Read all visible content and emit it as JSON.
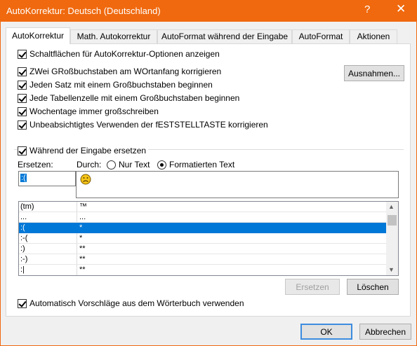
{
  "window": {
    "title": "AutoKorrektur: Deutsch (Deutschland)",
    "help_glyph": "?",
    "close_glyph": "✕",
    "accent_color": "#f0690e"
  },
  "tabs": [
    {
      "label": "AutoKorrektur",
      "active": true
    },
    {
      "label": "Math. Autokorrektur",
      "active": false
    },
    {
      "label": "AutoFormat während der Eingabe",
      "active": false
    },
    {
      "label": "AutoFormat",
      "active": false
    },
    {
      "label": "Aktionen",
      "active": false
    }
  ],
  "options": {
    "show_buttons": {
      "label": "Schaltflächen für AutoKorrektur-Optionen anzeigen",
      "checked": true
    },
    "two_caps": {
      "label": "ZWei GRoßbuchstaben am WOrtanfang korrigieren",
      "checked": true
    },
    "sentence_caps": {
      "label": "Jeden Satz mit einem Großbuchstaben beginnen",
      "checked": true
    },
    "table_cell_caps": {
      "label": "Jede Tabellenzelle mit einem Großbuchstaben beginnen",
      "checked": true
    },
    "weekday_caps": {
      "label": "Wochentage immer großschreiben",
      "checked": true
    },
    "caps_lock": {
      "label": "Unbeabsichtigtes Verwenden der fESTSTELLTASTE korrigieren",
      "checked": true
    },
    "replace_while_typing": {
      "label": "Während der Eingabe ersetzen",
      "checked": true
    },
    "dictionary_suggestions": {
      "label": "Automatisch Vorschläge aus dem Wörterbuch verwenden",
      "checked": true
    }
  },
  "buttons": {
    "exceptions": "Ausnahmen...",
    "replace": "Ersetzen",
    "delete": "Löschen",
    "ok": "OK",
    "cancel": "Abbrechen"
  },
  "replace_section": {
    "replace_label": "Ersetzen:",
    "with_label": "Durch:",
    "radio_plain": {
      "label": "Nur Text",
      "selected": false
    },
    "radio_formatted": {
      "label": "Formatierten Text",
      "selected": true
    },
    "replace_value": ":(",
    "with_value_icon": "frowning-face-emoji"
  },
  "list": {
    "rows": [
      {
        "from": "(tm)",
        "to": "™",
        "selected": false
      },
      {
        "from": "...",
        "to": "...",
        "selected": false
      },
      {
        "from": ":(",
        "to": "*",
        "selected": true
      },
      {
        "from": ":-(",
        "to": "*",
        "selected": false
      },
      {
        "from": ":)",
        "to": "**",
        "selected": false
      },
      {
        "from": ":-)",
        "to": "**",
        "selected": false
      },
      {
        "from": ":|",
        "to": "**",
        "selected": false
      }
    ]
  }
}
